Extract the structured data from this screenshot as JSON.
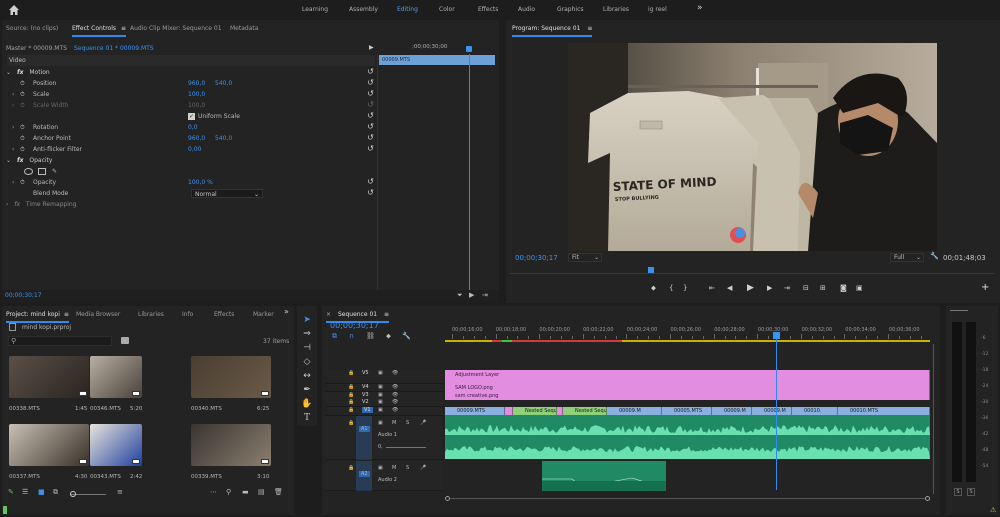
{
  "workspaces": {
    "items": [
      "Learning",
      "Assembly",
      "Editing",
      "Color",
      "Effects",
      "Audio",
      "Graphics",
      "Libraries",
      "ig reel"
    ],
    "active": "Editing",
    "more_label": "»"
  },
  "source_panel": {
    "tabs": [
      "Source: (no clips)",
      "Effect Controls",
      "Audio Clip Mixer: Sequence 01",
      "Metadata"
    ],
    "master_label": "Master * 00009.MTS",
    "sequence_label": "Sequence 01 * 00009.MTS",
    "timecode_top": ";00;00;30;00",
    "clip_name": "00009.MTS",
    "section_video": "Video",
    "motion": "Motion",
    "position": {
      "label": "Position",
      "x": "960,0",
      "y": "540,0"
    },
    "scale": {
      "label": "Scale",
      "value": "100,0"
    },
    "scale_width": {
      "label": "Scale Width",
      "value": "100,0"
    },
    "uniform_scale": "Uniform Scale",
    "rotation": {
      "label": "Rotation",
      "value": "0,0"
    },
    "anchor": {
      "label": "Anchor Point",
      "x": "960,0",
      "y": "540,0"
    },
    "antiflicker": {
      "label": "Anti-flicker Filter",
      "value": "0,00"
    },
    "opacity_section": "Opacity",
    "opacity": {
      "label": "Opacity",
      "value": "100,0 %"
    },
    "blend": {
      "label": "Blend Mode",
      "value": "Normal"
    },
    "time_remap": "Time Remapping",
    "bottom_timecode": "00;00;30;17"
  },
  "program": {
    "title": "Program: Sequence 01",
    "shirt_text": "STATE OF MIND",
    "shirt_sub": "STOP BULLYING",
    "timecode": "00;00;30;17",
    "fit": "Fit",
    "quality": "Full",
    "duration": "00;01;48;03"
  },
  "project": {
    "tabs": [
      "Project: mind kopi",
      "Media Browser",
      "Libraries",
      "Info",
      "Effects",
      "Marker"
    ],
    "file": "mind kopi.prproj",
    "count": "37 items",
    "items": [
      {
        "name": "00338.MTS",
        "duration": "1:45"
      },
      {
        "name": "00346.MTS",
        "duration": "5:20"
      },
      {
        "name": "00340.MTS",
        "duration": "6:25"
      },
      {
        "name": "00337.MTS",
        "duration": "4:30"
      },
      {
        "name": "00343.MTS",
        "duration": "2:42"
      },
      {
        "name": "00339.MTS",
        "duration": "3:10"
      }
    ]
  },
  "timeline": {
    "tab": "Sequence 01",
    "timecode": "00;00;30;17",
    "ticks": [
      "00;00;16;00",
      "00;00;18;00",
      "00;00;20;00",
      "00;00;22;00",
      "00;00;24;00",
      "00;00;26;00",
      "00;00;28;00",
      "00;00;30;00",
      "00;00;32;00",
      "00;00;34;00",
      "00;00;36;00"
    ],
    "tracks": [
      "V5",
      "V4",
      "V3",
      "V2",
      "V1",
      "A1",
      "A2"
    ],
    "v5_clip": "Adjustment Layer",
    "v4_clip": "SAM LOGO.png",
    "v3_clip": "sam creative.png",
    "v1_clips": [
      "00009.MTS",
      "Nested Sequen",
      "Nested Sequence",
      "00009.M",
      "00005.MTS",
      "00009.M",
      "00009.M",
      "00010.",
      "00010.MTS"
    ],
    "a1_label": "Audio 1",
    "a2_label": "Audio 2",
    "a1_vol": "0,",
    "m_label": "M",
    "s_label": "S"
  },
  "meter": {
    "levels": [
      "-6",
      "-12",
      "-18",
      "-24",
      "-30",
      "-36",
      "-42",
      "-48",
      "-54"
    ],
    "s_left": "S",
    "s_right": "S"
  }
}
